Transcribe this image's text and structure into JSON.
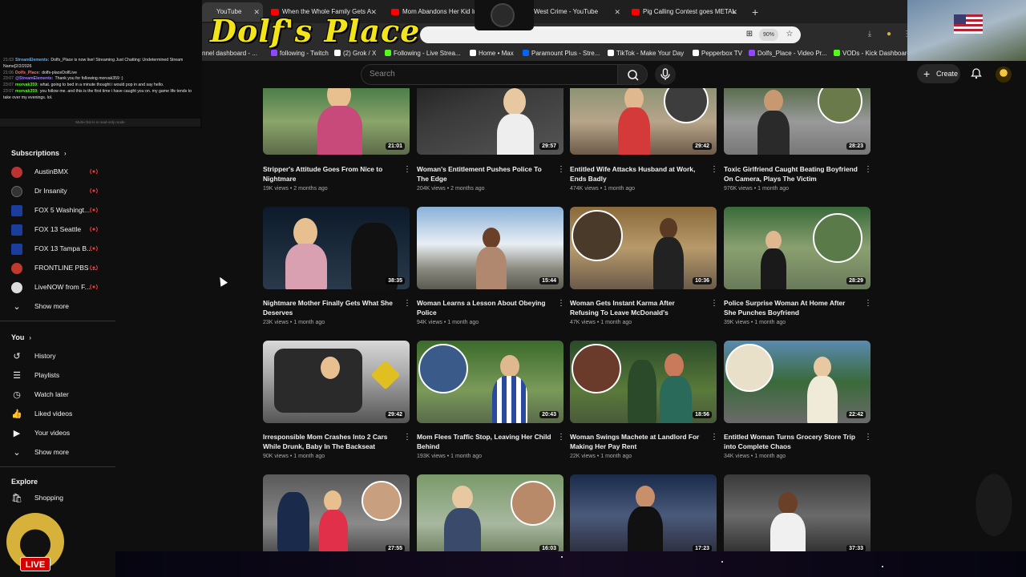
{
  "chat": {
    "lines": [
      {
        "time": "21:03",
        "user": "StreamElements:",
        "text": "Dolfs_Place is now live! Streaming Just Chatting: Undetermined Stream Name[2/2/2026"
      },
      {
        "time": "21:06",
        "user": "Dolfs_Place:",
        "text": "dolfs-placeDolfLive"
      },
      {
        "time": "23:07",
        "user": "@StreamElements:",
        "text": "Thank you for following morvak359 :)"
      },
      {
        "time": "23:07",
        "user": "morvak359:",
        "text": "what. going to bed in a minute thought i would pop in and say hello."
      },
      {
        "time": "23:07",
        "user": "morvak359:",
        "text": "you follow me. and this is the first time i have caught you on. my game life tends to take over my evenings. lol."
      }
    ],
    "footer": "Multi-chat is in read-only mode"
  },
  "overlay": {
    "logo": "Dolf's Place"
  },
  "browser": {
    "tabs": [
      {
        "label": "YouTube",
        "active": true
      },
      {
        "label": "When the Whole Family Gets A",
        "active": false
      },
      {
        "label": "Mom Abandons Her Kid In",
        "active": false
      },
      {
        "label": "West Crime - YouTube",
        "active": false
      },
      {
        "label": "Pig Calling Contest goes METAL",
        "active": false
      }
    ],
    "zoom": "90%",
    "bookmarks": [
      {
        "label": "nnel dashboard - ...",
        "color": "#9146ff"
      },
      {
        "label": "following - Twitch",
        "color": "#9146ff"
      },
      {
        "label": "(2) Grok / X",
        "color": "#ffffff"
      },
      {
        "label": "Following - Live Strea...",
        "color": "#53fc18"
      },
      {
        "label": "Home • Max",
        "color": "#002be7"
      },
      {
        "label": "Paramount Plus - Stre...",
        "color": "#0064ff"
      },
      {
        "label": "TikTok - Make Your Day",
        "color": "#ffffff"
      },
      {
        "label": "Pepperbox TV",
        "color": "#ffffff"
      },
      {
        "label": "Dolfs_Place - Video Pr...",
        "color": "#9146ff"
      },
      {
        "label": "VODs - Kick Dashboard",
        "color": "#53fc18"
      }
    ]
  },
  "header": {
    "search_placeholder": "Search",
    "create_label": "Create"
  },
  "sidebar": {
    "subscriptions_title": "Subscriptions",
    "subscriptions": [
      {
        "label": "AustinBMX",
        "color": "#b33"
      },
      {
        "label": "Dr Insanity",
        "color": "#222"
      },
      {
        "label": "FOX 5 Washingt...",
        "color": "#1a3d9e"
      },
      {
        "label": "FOX 13 Seattle",
        "color": "#1a3d9e"
      },
      {
        "label": "FOX 13 Tampa B...",
        "color": "#1a3d9e"
      },
      {
        "label": "FRONTLINE PBS ...",
        "color": "#c0392b"
      },
      {
        "label": "LiveNOW from F...",
        "color": "#ddd"
      }
    ],
    "show_more": "Show more",
    "you_title": "You",
    "you_items": [
      {
        "label": "History",
        "icon": "history-icon"
      },
      {
        "label": "Playlists",
        "icon": "playlists-icon"
      },
      {
        "label": "Watch later",
        "icon": "watch-later-icon"
      },
      {
        "label": "Liked videos",
        "icon": "liked-videos-icon"
      },
      {
        "label": "Your videos",
        "icon": "your-videos-icon"
      }
    ],
    "show_more_2": "Show more",
    "explore_title": "Explore",
    "explore_items": [
      {
        "label": "Shopping",
        "icon": "shopping-icon"
      }
    ],
    "live_badge": "LIVE"
  },
  "videos": [
    {
      "title": "Stripper's Attitude Goes From Nice to Nightmare",
      "views": "19K views",
      "age": "2 months ago",
      "duration": "21:01"
    },
    {
      "title": "Woman's Entitlement Pushes Police To The Edge",
      "views": "204K views",
      "age": "2 months ago",
      "duration": "29:57"
    },
    {
      "title": "Entitled Wife Attacks Husband at Work, Ends Badly",
      "views": "474K views",
      "age": "1 month ago",
      "duration": "29:42"
    },
    {
      "title": "Toxic Girlfriend Caught Beating Boyfriend On Camera, Plays The Victim",
      "views": "976K views",
      "age": "1 month ago",
      "duration": "28:23"
    },
    {
      "title": "Nightmare Mother Finally Gets What She Deserves",
      "views": "23K views",
      "age": "1 month ago",
      "duration": "38:35"
    },
    {
      "title": "Woman Learns a Lesson About Obeying Police",
      "views": "94K views",
      "age": "1 month ago",
      "duration": "15:44"
    },
    {
      "title": "Woman Gets Instant Karma After Refusing To Leave McDonald's",
      "views": "47K views",
      "age": "1 month ago",
      "duration": "10:36"
    },
    {
      "title": "Police Surprise Woman At Home After She Punches Boyfriend",
      "views": "39K views",
      "age": "1 month ago",
      "duration": "28:29"
    },
    {
      "title": "Irresponsible Mom Crashes Into 2 Cars While Drunk, Baby In The Backseat",
      "views": "90K views",
      "age": "1 month ago",
      "duration": "29:42"
    },
    {
      "title": "Mom Flees Traffic Stop, Leaving Her Child Behind",
      "views": "193K views",
      "age": "1 month ago",
      "duration": "20:43"
    },
    {
      "title": "Woman Swings Machete at Landlord For Making Her Pay Rent",
      "views": "22K views",
      "age": "1 month ago",
      "duration": "18:56"
    },
    {
      "title": "Entitled Woman Turns Grocery Store Trip into Complete Chaos",
      "views": "34K views",
      "age": "1 month ago",
      "duration": "22:42"
    },
    {
      "title": "",
      "views": "",
      "age": "",
      "duration": "27:55"
    },
    {
      "title": "",
      "views": "",
      "age": "",
      "duration": "16:03"
    },
    {
      "title": "",
      "views": "",
      "age": "",
      "duration": "17:23"
    },
    {
      "title": "",
      "views": "",
      "age": "",
      "duration": "37:33"
    }
  ]
}
